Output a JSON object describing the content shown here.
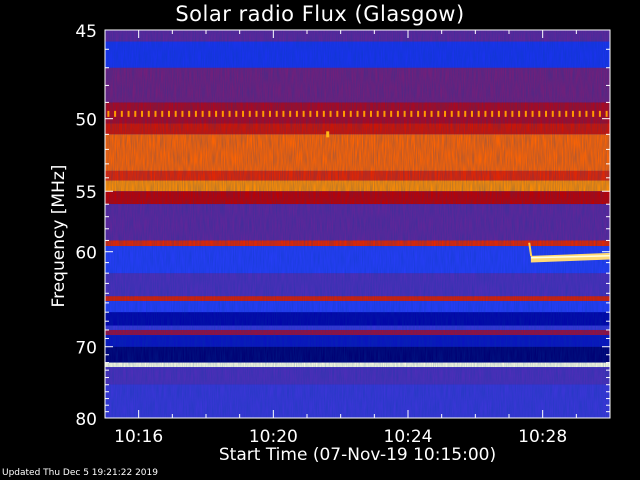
{
  "title": "Solar radio Flux (Glasgow)",
  "footer": "Updated Thu Dec  5 19:21:22 2019",
  "chart_data": {
    "type": "heatmap",
    "title": "Solar radio Flux (Glasgow)",
    "xlabel": "Start Time (07-Nov-19 10:15:00)",
    "ylabel": "Frequency [MHz]",
    "x_ticks": [
      "10:16",
      "10:20",
      "10:24",
      "10:28"
    ],
    "x_tick_minutes": [
      1,
      5,
      9,
      13
    ],
    "xlim_minutes": [
      0,
      15
    ],
    "y_ticks": [
      45,
      50,
      55,
      60,
      70,
      80
    ],
    "ylim": [
      45,
      80
    ],
    "y_scale": "reciprocal",
    "colormap": [
      "#000000",
      "#0000a0",
      "#2040ff",
      "#c00000",
      "#ff4000",
      "#ffb000",
      "#ffffe0"
    ],
    "bands": [
      {
        "f_start": 45.0,
        "f_end": 45.6,
        "intensity": 0.4
      },
      {
        "f_start": 45.6,
        "f_end": 47.0,
        "intensity": 0.3
      },
      {
        "f_start": 47.0,
        "f_end": 49.0,
        "intensity": 0.42
      },
      {
        "f_start": 49.0,
        "f_end": 50.3,
        "intensity": 0.48
      },
      {
        "f_start": 50.3,
        "f_end": 51.0,
        "intensity": 0.55
      },
      {
        "f_start": 51.0,
        "f_end": 53.5,
        "intensity": 0.72
      },
      {
        "f_start": 53.5,
        "f_end": 54.2,
        "intensity": 0.6
      },
      {
        "f_start": 54.2,
        "f_end": 55.0,
        "intensity": 0.78
      },
      {
        "f_start": 55.0,
        "f_end": 56.0,
        "intensity": 0.5
      },
      {
        "f_start": 56.0,
        "f_end": 59.0,
        "intensity": 0.4
      },
      {
        "f_start": 59.0,
        "f_end": 59.5,
        "intensity": 0.6
      },
      {
        "f_start": 59.5,
        "f_end": 62.0,
        "intensity": 0.34
      },
      {
        "f_start": 62.0,
        "f_end": 64.3,
        "intensity": 0.38
      },
      {
        "f_start": 64.3,
        "f_end": 64.8,
        "intensity": 0.58
      },
      {
        "f_start": 64.8,
        "f_end": 66.0,
        "intensity": 0.34
      },
      {
        "f_start": 66.0,
        "f_end": 67.5,
        "intensity": 0.18
      },
      {
        "f_start": 67.5,
        "f_end": 68.0,
        "intensity": 0.36
      },
      {
        "f_start": 68.0,
        "f_end": 68.6,
        "intensity": 0.46
      },
      {
        "f_start": 68.6,
        "f_end": 70.0,
        "intensity": 0.22
      },
      {
        "f_start": 70.0,
        "f_end": 72.0,
        "intensity": 0.12
      },
      {
        "f_start": 72.0,
        "f_end": 72.6,
        "intensity": 1.0
      },
      {
        "f_start": 72.6,
        "f_end": 75.0,
        "intensity": 0.38
      },
      {
        "f_start": 75.0,
        "f_end": 80.0,
        "intensity": 0.36
      }
    ],
    "features": [
      {
        "name": "periodic-spike-comb",
        "freq": 49.7,
        "intensity": 0.8,
        "t_start": 0,
        "t_end": 15,
        "period_minutes": 0.2
      },
      {
        "name": "spike",
        "freq": 51.0,
        "intensity": 0.85,
        "t_minute": 6.6
      },
      {
        "name": "emission-ridge",
        "freq_start": 60.2,
        "freq_end": 60.9,
        "intensity": 0.92,
        "t_start": 12.65,
        "t_end": 15
      },
      {
        "name": "drift-spike",
        "freq_start": 59.2,
        "freq_end": 60.4,
        "intensity": 0.9,
        "t_minute": 12.6
      }
    ]
  }
}
